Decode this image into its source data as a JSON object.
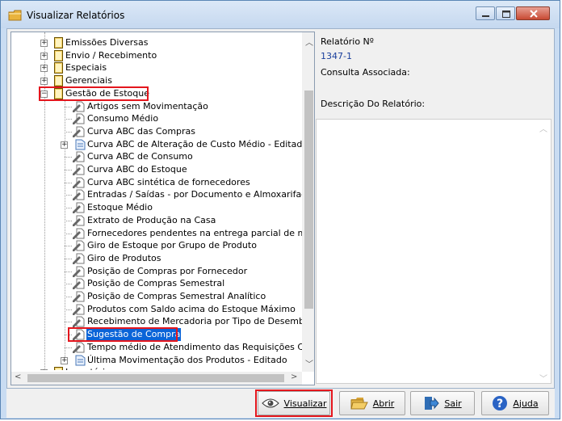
{
  "window": {
    "title": "Visualizar Relatórios"
  },
  "tree": {
    "items": [
      {
        "label": "Emissões Diversas",
        "type": "folder"
      },
      {
        "label": "Envio / Recebimento",
        "type": "folder"
      },
      {
        "label": "Especiais",
        "type": "folder"
      },
      {
        "label": "Gerenciais",
        "type": "folder"
      },
      {
        "label": "Gestão de Estoque",
        "type": "folder-open"
      },
      {
        "label": "Artigos sem Movimentação",
        "type": "report"
      },
      {
        "label": "Consumo Médio",
        "type": "report"
      },
      {
        "label": "Curva ABC das Compras",
        "type": "report"
      },
      {
        "label": "Curva ABC de Alteração de Custo Médio - Editado",
        "type": "report-group"
      },
      {
        "label": "Curva ABC de Consumo",
        "type": "report"
      },
      {
        "label": "Curva ABC do Estoque",
        "type": "report"
      },
      {
        "label": "Curva ABC sintética de fornecedores",
        "type": "report"
      },
      {
        "label": "Entradas / Saídas - por Documento e Almoxarifado",
        "type": "report"
      },
      {
        "label": "Estoque Médio",
        "type": "report"
      },
      {
        "label": "Extrato de Produção na Casa",
        "type": "report"
      },
      {
        "label": "Fornecedores pendentes na entrega parcial de mercad",
        "type": "report"
      },
      {
        "label": "Giro de Estoque por Grupo de Produto",
        "type": "report"
      },
      {
        "label": "Giro de Produtos",
        "type": "report"
      },
      {
        "label": "Posição de Compras por Fornecedor",
        "type": "report"
      },
      {
        "label": "Posição de Compras Semestral",
        "type": "report"
      },
      {
        "label": "Posição de Compras Semestral Analítico",
        "type": "report"
      },
      {
        "label": "Produtos com Saldo acima do Estoque Máximo",
        "type": "report"
      },
      {
        "label": "Recebimento de Mercadoria por Tipo de Desembolso",
        "type": "report"
      },
      {
        "label": "Sugestão de Compra",
        "type": "report-selected"
      },
      {
        "label": "Tempo médio de Atendimento das Requisições Cadast",
        "type": "report"
      },
      {
        "label": "Última Movimentação dos Produtos - Editado",
        "type": "report-group"
      },
      {
        "label": "Inventários",
        "type": "folder"
      }
    ]
  },
  "details": {
    "report_number_label": "Relatório Nº",
    "report_number_value": "1347-1",
    "query_label": "Consulta Associada:",
    "description_label": "Descrição Do Relatório:"
  },
  "buttons": {
    "view": {
      "label": "Visualizar",
      "accesskey": "V"
    },
    "open": {
      "label": "Abrir",
      "accesskey": "A"
    },
    "exit": {
      "label": "Sair",
      "accesskey": "S"
    },
    "help": {
      "label": "Ajuda",
      "accesskey": "j"
    }
  },
  "colors": {
    "highlight": "#e4161d",
    "selection": "#0a64d8",
    "link": "#1a3f9c"
  }
}
